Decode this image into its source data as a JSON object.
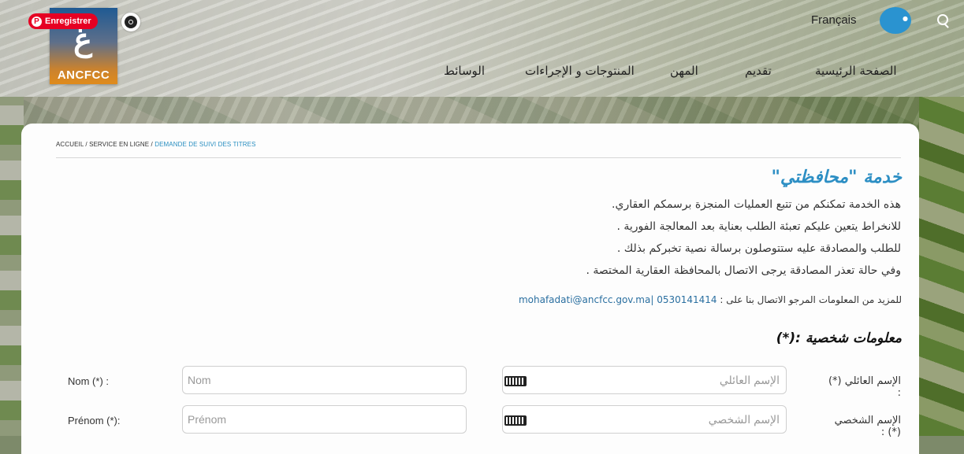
{
  "header": {
    "logo_glyph": "غ",
    "logo_abbr": "ANCFCC",
    "pinterest_label": "Enregistrer",
    "language": "Français",
    "nav": [
      "الصفحة الرئيسية",
      "تقديم",
      "المهن",
      "المنتوجات و الإجراءات",
      "الوسائط"
    ]
  },
  "breadcrumb": {
    "home": "ACCUEIL",
    "sep1": " / ",
    "service": "SERVICE EN LIGNE",
    "sep2": " / ",
    "current": "DEMANDE DE SUIVI DES TITRES"
  },
  "content": {
    "title": "خدمة \"محافظتي\"",
    "paragraphs": [
      "هذه الخدمة تمكنكم من تتبع العمليات المنجزة برسمكم العقاري.",
      "للانخراط يتعين عليكم تعبئة الطلب بعناية بعد المعالجة الفورية .",
      "للطلب والمصادقة عليه ستتوصلون برسالة نصية تخبركم بذلك .",
      "وفي حالة تعذر المصادقة يرجى الاتصال بالمحافظة العقارية المختصة ."
    ],
    "contact_prefix": "للمزيد من المعلومات المرجو الاتصال بنا على :",
    "contact_link": "0530141414 |mohafadati@ancfcc.gov.ma",
    "section_title": "معلومات شخصية :(*)"
  },
  "form": {
    "nom_label_fr": "Nom (*) :",
    "nom_placeholder_fr": "Nom",
    "nom_label_ar": "الإسم العائلي (*) :",
    "nom_placeholder_ar": "الإسم العائلي",
    "prenom_label_fr": "Prénom (*):",
    "prenom_placeholder_fr": "Prénom",
    "prenom_label_ar": "الإسم الشخصي (*) :",
    "prenom_placeholder_ar": "الإسم الشخصي"
  },
  "colors": {
    "accent": "#2d8fc4",
    "pinterest": "#e60023",
    "link": "#2a6fa0"
  }
}
